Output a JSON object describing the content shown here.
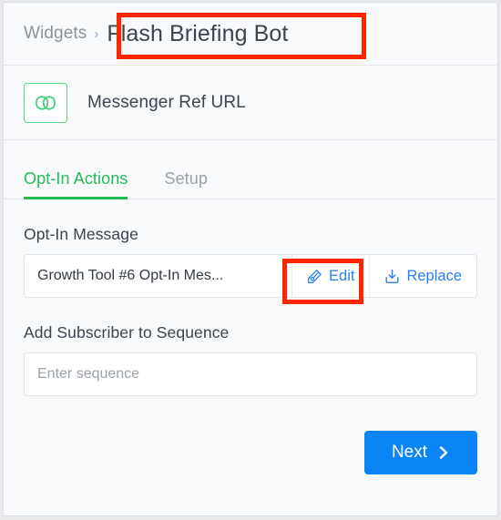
{
  "breadcrumb": {
    "parent": "Widgets",
    "separator": "›",
    "current": "Flash Briefing Bot"
  },
  "tool": {
    "icon": "link-chain-icon",
    "title": "Messenger Ref URL",
    "icon_color": "#5ad882"
  },
  "tabs": [
    {
      "label": "Opt-In Actions",
      "active": true
    },
    {
      "label": "Setup",
      "active": false
    }
  ],
  "opt_in_message": {
    "label": "Opt-In Message",
    "value": "Growth Tool #6 Opt-In Mes...",
    "actions": [
      {
        "label": "Edit",
        "icon": "pen-nib-icon"
      },
      {
        "label": "Replace",
        "icon": "download-tray-icon"
      }
    ]
  },
  "sequence": {
    "label": "Add Subscriber to Sequence",
    "value": "",
    "placeholder": "Enter sequence"
  },
  "footer": {
    "next_label": "Next",
    "next_icon": "chevron-right-icon",
    "next_color": "#0b84f5"
  },
  "annotations": {
    "highlight_color": "#fe2600",
    "boxes": [
      "title-highlight",
      "edit-highlight"
    ]
  }
}
